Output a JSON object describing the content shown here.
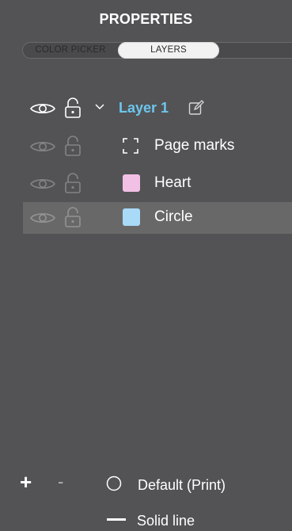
{
  "panel": {
    "title": "PROPERTIES"
  },
  "tabs": [
    {
      "label": "COLOR PICKER",
      "active": false
    },
    {
      "label": "LAYERS",
      "active": true
    }
  ],
  "layers": {
    "parent": {
      "name": "Layer 1",
      "name_color": "#6cc6ee",
      "expanded": true,
      "visible": true,
      "locked": false
    },
    "children": [
      {
        "name": "Page marks",
        "icon": "page-marks-icon",
        "swatch": null,
        "selected": false
      },
      {
        "name": "Heart",
        "icon": "swatch",
        "swatch": "#f2c0e4",
        "selected": false
      },
      {
        "name": "Circle",
        "icon": "swatch",
        "swatch": "#a9daf8",
        "selected": true
      }
    ]
  },
  "bottom": {
    "add": "+",
    "remove": "-",
    "color_mode": "Default (Print)",
    "line_style": "Solid line"
  }
}
